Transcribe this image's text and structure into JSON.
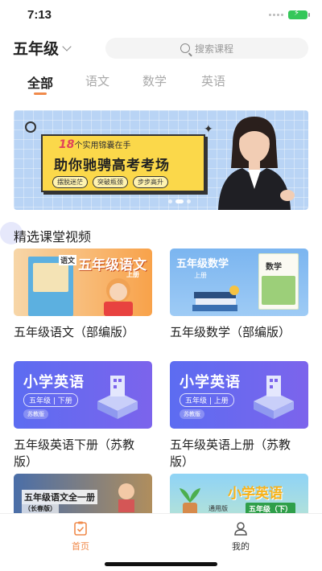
{
  "status_bar": {
    "time": "7:13"
  },
  "header": {
    "grade": "五年级",
    "search_placeholder": "搜索课程"
  },
  "tabs": [
    {
      "label": "全部",
      "active": true
    },
    {
      "label": "语文",
      "active": false
    },
    {
      "label": "数学",
      "active": false
    },
    {
      "label": "英语",
      "active": false
    }
  ],
  "banner": {
    "number": "18",
    "top_text": "个实用锦囊在手",
    "headline": "助你驰骋高考考场",
    "tags": [
      "摆脱迷茫",
      "突破瓶颈",
      "步步高升"
    ]
  },
  "section": {
    "title": "精选课堂视频"
  },
  "courses": [
    {
      "title": "五年级语文（部编版）",
      "thumb_title": "五年级语文",
      "thumb_sub": "语文",
      "thumb_note": "上册"
    },
    {
      "title": "五年级数学（部编版）",
      "thumb_title": "五年级数学",
      "thumb_sub": "数学",
      "thumb_note": "上册"
    },
    {
      "title": "五年级英语下册（苏教版）",
      "thumb_title": "小学英语",
      "thumb_sub": "五年级 | 下册",
      "thumb_note": "苏教版"
    },
    {
      "title": "五年级英语上册（苏教版）",
      "thumb_title": "小学英语",
      "thumb_sub": "五年级 | 上册",
      "thumb_note": "苏教版"
    },
    {
      "title": "",
      "thumb_title": "五年级语文全一册",
      "thumb_sub": "（长春版）",
      "thumb_note": ""
    },
    {
      "title": "",
      "thumb_title": "小学英语",
      "thumb_sub": "通用版",
      "thumb_note": "五年级（下）"
    }
  ],
  "bottom_nav": [
    {
      "label": "首页",
      "icon": "home-clipboard-icon",
      "active": true
    },
    {
      "label": "我的",
      "icon": "user-icon",
      "active": false
    }
  ],
  "colors": {
    "accent": "#f08a4b",
    "english_card": "#5c6cf1",
    "banner_bg": "#b9d4f5",
    "banner_card": "#fbd84a"
  }
}
